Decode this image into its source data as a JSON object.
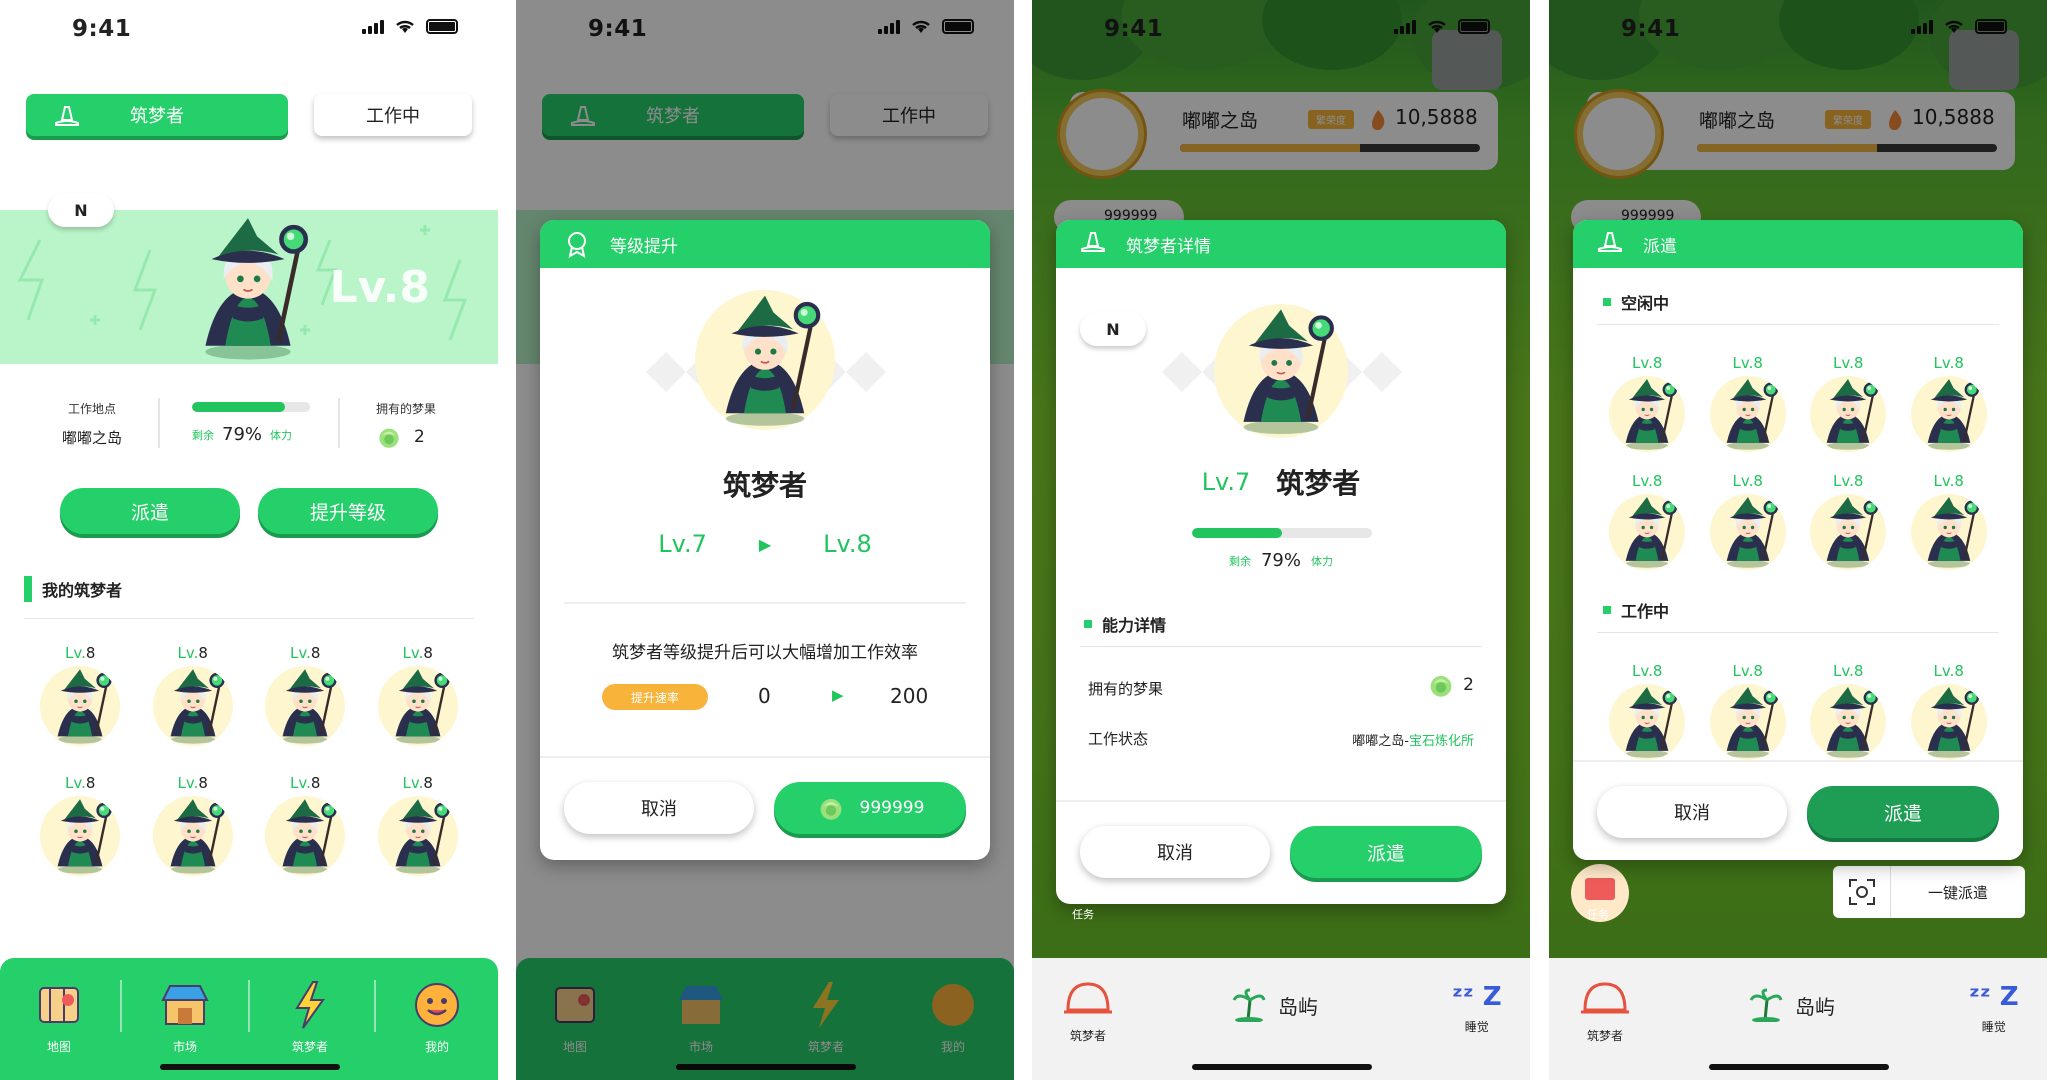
{
  "status": {
    "time": "9:41"
  },
  "screen1": {
    "tab_builder": "筑梦者",
    "tab_working": "工作中",
    "badge": "N",
    "level_big": "Lv.8",
    "work_location_label": "工作地点",
    "work_location_value": "嘟嘟之岛",
    "remain_label": "剩余",
    "stamina_pct": "79%",
    "stamina_label": "体力",
    "stamina_fill": 0.79,
    "fruit_label": "拥有的梦果",
    "fruit_count": "2",
    "dispatch_button": "派遣",
    "upgrade_button": "提升等级",
    "my_builders_title": "我的筑梦者",
    "builder_levels": [
      {
        "prefix": "Lv.",
        "num": "8"
      },
      {
        "prefix": "Lv.",
        "num": "8"
      },
      {
        "prefix": "Lv.",
        "num": "8"
      },
      {
        "prefix": "Lv.",
        "num": "8"
      },
      {
        "prefix": "Lv.",
        "num": "8"
      },
      {
        "prefix": "Lv.",
        "num": "8"
      },
      {
        "prefix": "Lv.",
        "num": "8"
      },
      {
        "prefix": "Lv.",
        "num": "8"
      }
    ],
    "nav": [
      "地图",
      "市场",
      "筑梦者",
      "我的"
    ]
  },
  "screen2": {
    "tab_builder": "筑梦者",
    "tab_working": "工作中",
    "modal_title": "等级提升",
    "name": "筑梦者",
    "level_from": "Lv.7",
    "level_to": "Lv.8",
    "desc": "筑梦者等级提升后可以大幅增加工作效率",
    "rate_tag": "提升速率",
    "rate_from": "0",
    "rate_to": "200",
    "cancel": "取消",
    "cost": "999999",
    "nav": [
      "地图",
      "市场",
      "筑梦者",
      "我的"
    ]
  },
  "hud": {
    "island": "嘟嘟之岛",
    "tag": "繁荣度",
    "score": "10,5888",
    "gem_count": "999999",
    "task_label": "任务"
  },
  "screen3": {
    "modal_title": "筑梦者详情",
    "badge": "N",
    "level": "Lv.7",
    "name": "筑梦者",
    "remain_label": "剩余",
    "stamina_pct": "79%",
    "stamina_label": "体力",
    "stamina_fill": 0.5,
    "ability_title": "能力详情",
    "fruit_label": "拥有的梦果",
    "fruit_count": "2",
    "status_label": "工作状态",
    "status_place": "嘟嘟之岛-",
    "status_link": "宝石炼化所",
    "cancel": "取消",
    "dispatch": "派遣",
    "nav": [
      "筑梦者",
      "岛屿",
      "睡觉"
    ]
  },
  "screen4": {
    "modal_title": "派遣",
    "idle_title": "空闲中",
    "working_title": "工作中",
    "idle_levels": [
      "Lv.8",
      "Lv.8",
      "Lv.8",
      "Lv.8",
      "Lv.8",
      "Lv.8",
      "Lv.8",
      "Lv.8"
    ],
    "working_levels": [
      "Lv.8",
      "Lv.8",
      "Lv.8",
      "Lv.8"
    ],
    "cancel": "取消",
    "dispatch": "派遣",
    "one_click": "一键派遣",
    "nav": [
      "筑梦者",
      "岛屿",
      "睡觉"
    ]
  },
  "colors": {
    "accent": "#25cf6a",
    "accent_dark": "#1a9c4f",
    "gold": "#f8b43a",
    "level_green": "#22c45e"
  }
}
